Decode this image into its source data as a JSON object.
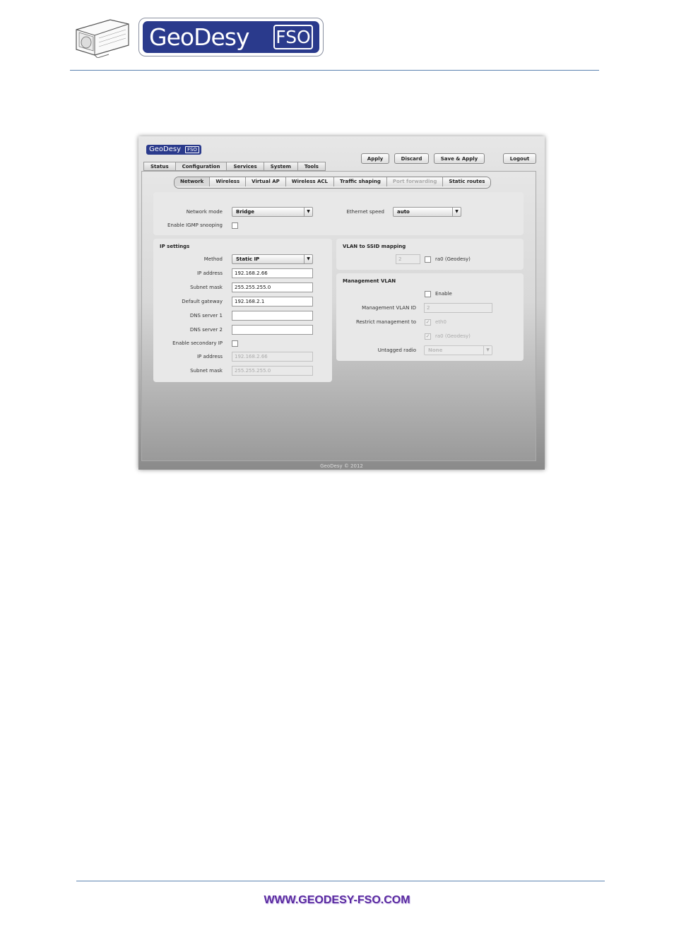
{
  "doc": {
    "brand_name": "GeoDesy",
    "brand_fso": "FSO",
    "footer_url": "WWW.GEODESY-FSO.COM"
  },
  "app": {
    "logo_name": "GeoDesy",
    "logo_fso": "FSO",
    "buttons": {
      "apply": "Apply",
      "discard": "Discard",
      "save_apply": "Save & Apply",
      "logout": "Logout"
    },
    "main_tabs": [
      "Status",
      "Configuration",
      "Services",
      "System",
      "Tools"
    ],
    "active_main_tab": "Configuration",
    "sub_tabs": [
      "Network",
      "Wireless",
      "Virtual AP",
      "Wireless ACL",
      "Traffic shaping",
      "Port forwarding",
      "Static routes"
    ],
    "active_sub_tab": "Network",
    "disabled_sub_tab": "Port forwarding",
    "copyright": "GeoDesy © 2012"
  },
  "general": {
    "network_mode_label": "Network mode",
    "network_mode_value": "Bridge",
    "ethernet_speed_label": "Ethernet speed",
    "ethernet_speed_value": "auto",
    "igmp_label": "Enable IGMP snooping",
    "igmp_checked": false
  },
  "ip_settings": {
    "title": "IP settings",
    "method_label": "Method",
    "method_value": "Static IP",
    "ip_label": "IP address",
    "ip_value": "192.168.2.66",
    "mask_label": "Subnet mask",
    "mask_value": "255.255.255.0",
    "gateway_label": "Default gateway",
    "gateway_value": "192.168.2.1",
    "dns1_label": "DNS server 1",
    "dns1_value": "",
    "dns2_label": "DNS server 2",
    "dns2_value": "",
    "secondary_label": "Enable secondary IP",
    "sec_ip_label": "IP address",
    "sec_ip_value": "192.168.2.66",
    "sec_mask_label": "Subnet mask",
    "sec_mask_value": "255.255.255.0"
  },
  "vlan_ssid": {
    "title": "VLAN to SSID mapping",
    "vlan_value": "2",
    "ssid_label": "ra0 (Geodesy)"
  },
  "mgmt_vlan": {
    "title": "Management VLAN",
    "enable_label": "Enable",
    "vlan_id_label": "Management VLAN ID",
    "vlan_id_value": "2",
    "restrict_label": "Restrict management to",
    "restrict_eth": "eth0",
    "restrict_ra": "ra0 (Geodesy)",
    "untagged_label": "Untagged radio",
    "untagged_value": "None"
  }
}
